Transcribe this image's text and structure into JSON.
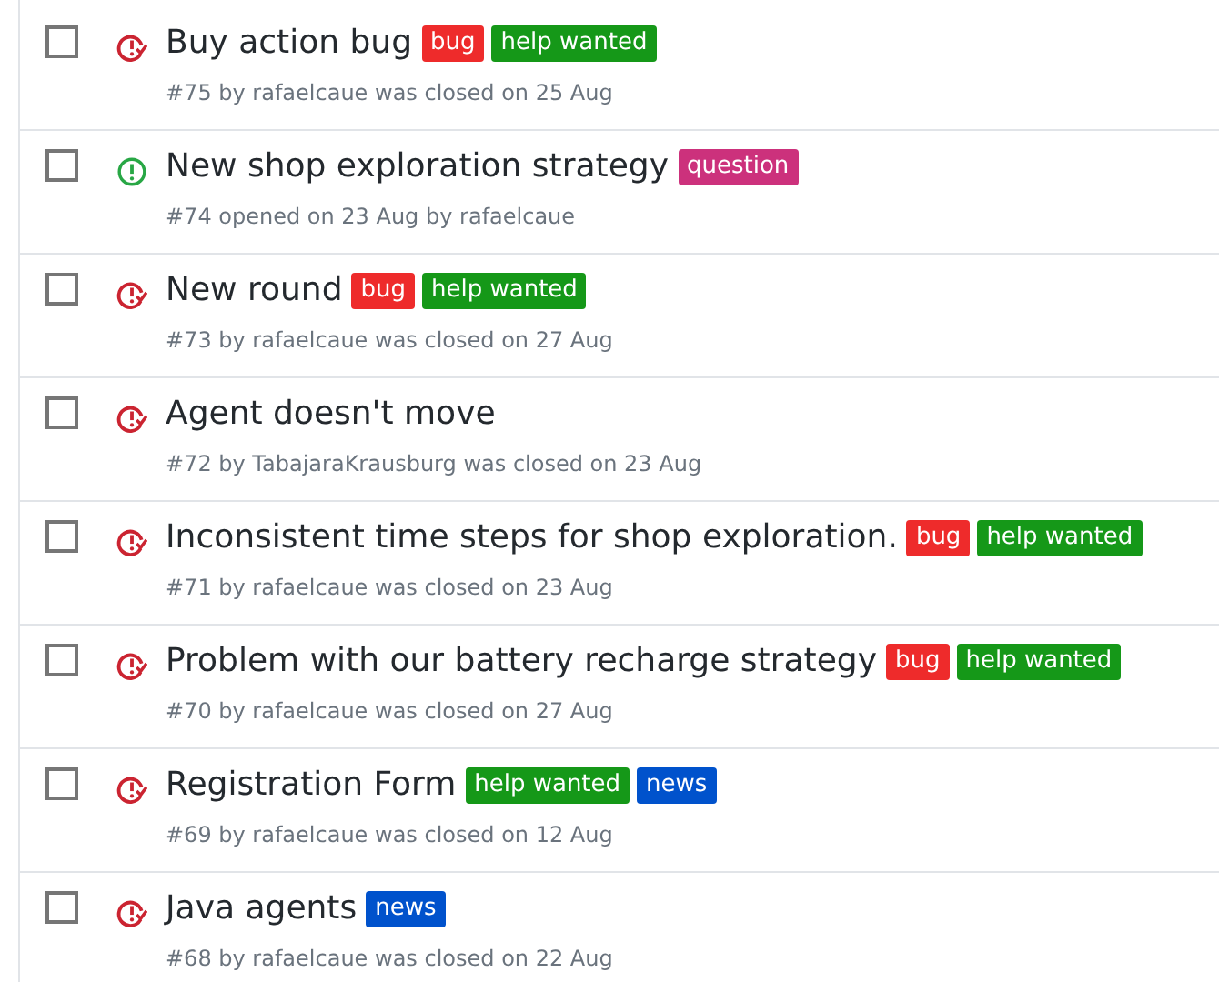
{
  "issues": [
    {
      "title": "Buy action bug",
      "kind": "closed",
      "checked": false,
      "labels": [
        {
          "text": "bug",
          "color": "#ee2b2b"
        },
        {
          "text": "help wanted",
          "color": "#159818"
        }
      ],
      "meta": "#75 by rafaelcaue was closed on 25 Aug"
    },
    {
      "title": "New shop exploration strategy",
      "kind": "open",
      "checked": false,
      "labels": [
        {
          "text": "question",
          "color": "#cc317c"
        }
      ],
      "meta": "#74 opened on 23 Aug by rafaelcaue"
    },
    {
      "title": "New round",
      "kind": "closed",
      "checked": false,
      "labels": [
        {
          "text": "bug",
          "color": "#ee2b2b"
        },
        {
          "text": "help wanted",
          "color": "#159818"
        }
      ],
      "meta": "#73 by rafaelcaue was closed on 27 Aug"
    },
    {
      "title": "Agent doesn't move",
      "kind": "closed",
      "checked": false,
      "meta": "#72 by TabajaraKrausburg was closed on 23 Aug"
    },
    {
      "title": "Inconsistent time steps for shop exploration.",
      "kind": "closed",
      "checked": false,
      "labels": [
        {
          "text": "bug",
          "color": "#ee2b2b"
        },
        {
          "text": "help wanted",
          "color": "#159818"
        }
      ],
      "meta": "#71 by rafaelcaue was closed on 23 Aug"
    },
    {
      "title": "Problem with our battery recharge strategy",
      "kind": "closed",
      "checked": false,
      "labels": [
        {
          "text": "bug",
          "color": "#ee2b2b"
        },
        {
          "text": "help wanted",
          "color": "#159818"
        }
      ],
      "meta": "#70 by rafaelcaue was closed on 27 Aug"
    },
    {
      "title": "Registration Form",
      "kind": "closed",
      "checked": false,
      "labels": [
        {
          "text": "help wanted",
          "color": "#159818"
        },
        {
          "text": "news",
          "color": "#0052cc"
        }
      ],
      "meta": "#69 by rafaelcaue was closed on 12 Aug"
    },
    {
      "title": "Java agents",
      "kind": "closed",
      "checked": false,
      "labels": [
        {
          "text": "news",
          "color": "#0052cc"
        }
      ],
      "meta": "#68 by rafaelcaue was closed on 22 Aug"
    }
  ]
}
